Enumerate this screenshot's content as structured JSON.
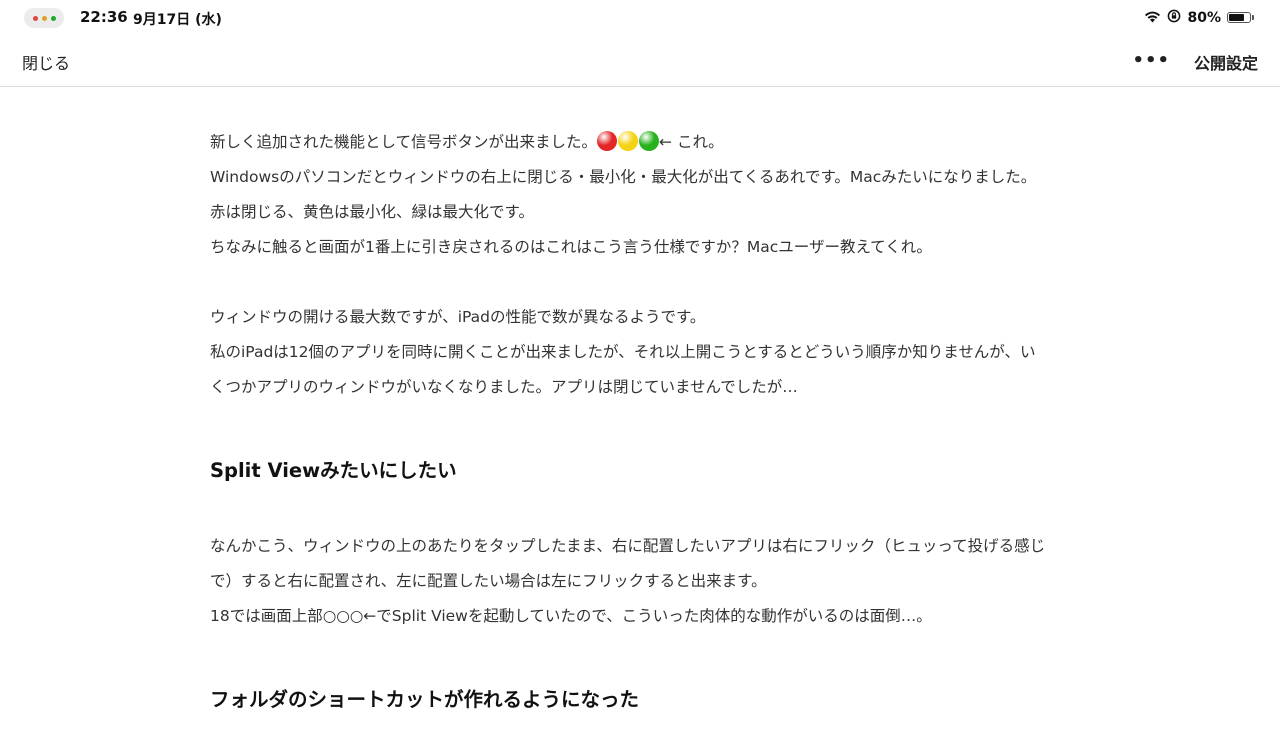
{
  "status_bar": {
    "time": "22:36",
    "date": "9月17日 (水)",
    "battery_percent": "80%",
    "battery_level": 0.8,
    "icons": [
      "wifi-icon",
      "orientation-lock-icon",
      "battery-icon"
    ],
    "window_dot_colors": [
      "#e0443e",
      "#dea123",
      "#1aab29"
    ]
  },
  "toolbar": {
    "close_label": "閉じる",
    "more_label": "•••",
    "publish_label": "公開設定"
  },
  "article": {
    "para1": {
      "line1_before": "新しく追加された機能として信号ボタンが出来ました。",
      "traffic_light_colors": [
        "#e32626",
        "#f5d214",
        "#27b21c"
      ],
      "line1_after": "← これ。",
      "line2": "Windowsのパソコンだとウィンドウの右上に閉じる・最小化・最大化が出てくるあれです。Macみたいになりました。",
      "line3": "赤は閉じる、黄色は最小化、緑は最大化です。",
      "line4": "ちなみに触ると画面が1番上に引き戻されるのはこれはこう言う仕様ですか？Macユーザー教えてくれ。"
    },
    "para2": {
      "line1": "ウィンドウの開ける最大数ですが、iPadの性能で数が異なるようです。",
      "line2": "私のiPadは12個のアプリを同時に開くことが出来ましたが、それ以上開こうとするとどういう順序か知りませんが、い",
      "line3": "くつかアプリのウィンドウがいなくなりました。アプリは閉じていませんでしたが…"
    },
    "heading1": "Split Viewみたいにしたい",
    "para3": {
      "line1": "なんかこう、ウィンドウの上のあたりをタップしたまま、右に配置したいアプリは右にフリック（ヒュッって投げる感じ",
      "line2": "で）すると右に配置され、左に配置したい場合は左にフリックすると出来ます。",
      "line3": "18では画面上部○○○←でSplit Viewを起動していたので、こういった肉体的な動作がいるのは面倒…。"
    },
    "heading2": "フォルダのショートカットが作れるようになった"
  }
}
